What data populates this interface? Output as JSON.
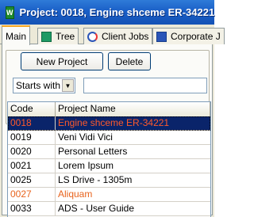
{
  "window": {
    "title": "Project: 0018, Engine shceme ER-34221",
    "icon_text": "W"
  },
  "tabs": [
    {
      "label": "Main",
      "icon": "none",
      "active": true
    },
    {
      "label": "Tree",
      "icon": "tree-icon"
    },
    {
      "label": "Client Jobs",
      "icon": "client-jobs-icon"
    },
    {
      "label": "Corporate J",
      "icon": "corporate-icon"
    }
  ],
  "toolbar": {
    "new_project_label": "New Project",
    "delete_label": "Delete"
  },
  "filter": {
    "mode": "Starts with",
    "search_value": ""
  },
  "grid": {
    "columns": [
      "Code",
      "Project Name"
    ],
    "rows": [
      {
        "code": "0018",
        "name": "Engine shceme ER-34221",
        "state": "selected"
      },
      {
        "code": "0019",
        "name": "Veni Vidi Vici",
        "state": "normal"
      },
      {
        "code": "0020",
        "name": "Personal Letters",
        "state": "normal"
      },
      {
        "code": "0021",
        "name": "Lorem Ipsum",
        "state": "normal"
      },
      {
        "code": "0025",
        "name": "LS Drive - 1305m",
        "state": "normal"
      },
      {
        "code": "0027",
        "name": "Aliquam",
        "state": "highlight"
      },
      {
        "code": "0033",
        "name": "ADS - User Guide",
        "state": "normal"
      }
    ]
  },
  "colors": {
    "title_bar": "#1a5fc7",
    "selected_row_bg": "#0a246a",
    "selected_row_text": "#ff5a2b",
    "highlight_text": "#e8631d"
  }
}
